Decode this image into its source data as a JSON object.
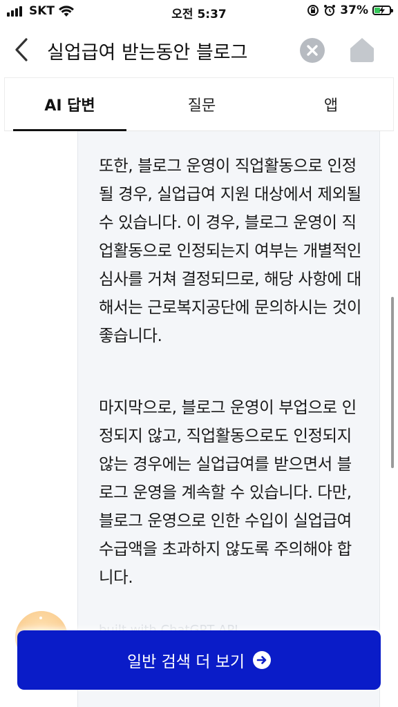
{
  "status_bar": {
    "carrier": "SKT",
    "time": "오전 5:37",
    "battery_percent": "37%",
    "battery_level": 0.37,
    "icons": [
      "signal-icon",
      "wifi-icon",
      "orientation-lock-icon",
      "alarm-icon",
      "battery-charging-icon"
    ]
  },
  "search": {
    "query": "실업급여 받는동안 블로그",
    "icons": [
      "back-chevron-icon",
      "clear-icon",
      "home-icon"
    ]
  },
  "tabs": [
    {
      "label": "AI 답변",
      "active": true
    },
    {
      "label": "질문",
      "active": false
    },
    {
      "label": "앱",
      "active": false
    }
  ],
  "answer": {
    "paragraphs": [
      "또한, 블로그 운영이 직업활동으로 인정될 경우, 실업급여 지원 대상에서 제외될 수 있습니다. 이 경우, 블로그 운영이 직업활동으로 인정되는지 여부는 개별적인 심사를 거쳐 결정되므로, 해당 사항에 대해서는 근로복지공단에 문의하시는 것이 좋습니다.",
      "마지막으로, 블로그 운영이 부업으로 인정되지 않고, 직업활동으로도 인정되지 않는 경우에는 실업급여를 받으면서 블로그 운영을 계속할 수 있습니다. 다만, 블로그 운영으로 인한 수입이 실업급여 수급액을 초과하지 않도록 주의해야 합니다."
    ],
    "footer": "built with ChatGPT API"
  },
  "cta": {
    "label": "일반 검색 더 보기",
    "color": "#0a1cc8"
  }
}
